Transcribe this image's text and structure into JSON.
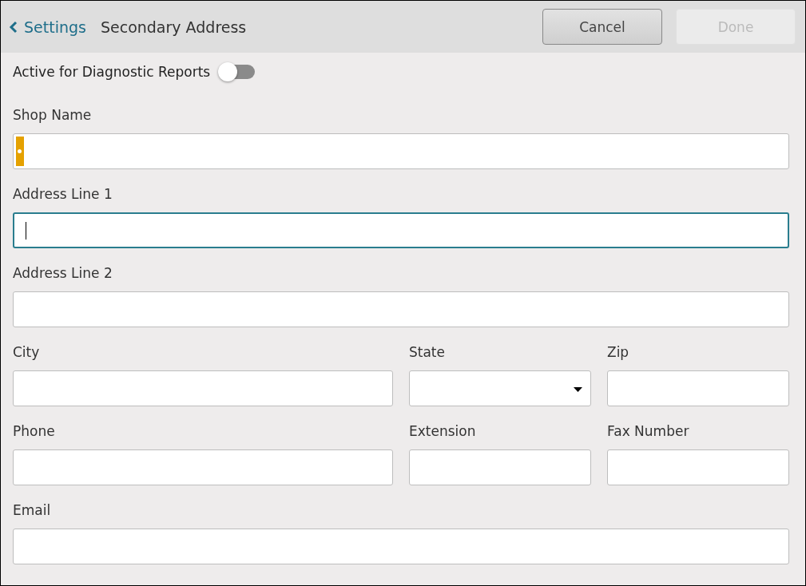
{
  "header": {
    "back_label": "Settings",
    "title": "Secondary Address",
    "buttons": [
      {
        "label": "Cancel",
        "disabled": false
      },
      {
        "label": "Done",
        "disabled": true
      }
    ]
  },
  "toggle": {
    "label": "Active for Diagnostic Reports",
    "on": false
  },
  "rows": [
    {
      "fields": [
        {
          "label": "Shop Name",
          "kind": "text",
          "focused": false
        }
      ]
    },
    {
      "fields": [
        {
          "label": "Address Line 1",
          "kind": "text",
          "focused": true
        }
      ]
    },
    {
      "fields": [
        {
          "label": "Address Line 2",
          "kind": "text",
          "focused": false
        }
      ]
    },
    {
      "fields": [
        {
          "label": "City",
          "kind": "text",
          "focused": false
        },
        {
          "label": "State",
          "kind": "select",
          "focused": false
        },
        {
          "label": "Zip",
          "kind": "text",
          "focused": false
        }
      ]
    },
    {
      "fields": [
        {
          "label": "Phone",
          "kind": "text",
          "focused": false
        },
        {
          "label": "Extension",
          "kind": "text",
          "focused": false
        },
        {
          "label": "Fax Number",
          "kind": "text",
          "focused": false
        }
      ]
    },
    {
      "fields": [
        {
          "label": "Email",
          "kind": "text",
          "focused": false
        }
      ]
    }
  ]
}
